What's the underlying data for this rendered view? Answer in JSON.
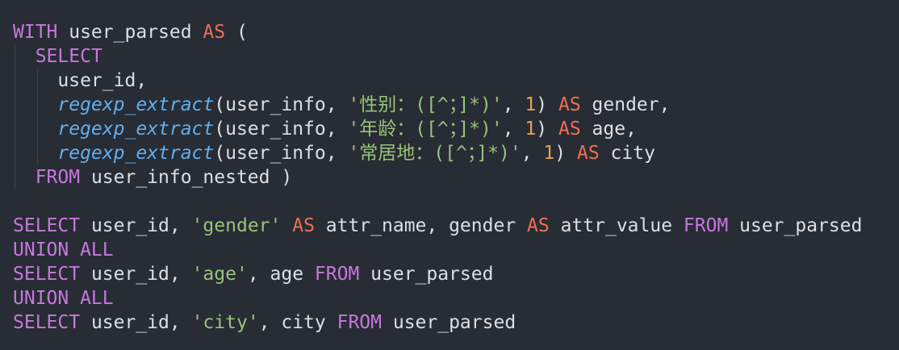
{
  "editor": {
    "lines": [
      {
        "indent": 0,
        "tokens": [
          {
            "t": "WITH",
            "k": "keyword"
          },
          {
            "t": " user_parsed ",
            "k": "ident"
          },
          {
            "t": "AS",
            "k": "as"
          },
          {
            "t": " (",
            "k": "punct"
          }
        ]
      },
      {
        "indent": 1,
        "tokens": [
          {
            "t": "SELECT",
            "k": "keyword"
          }
        ]
      },
      {
        "indent": 2,
        "tokens": [
          {
            "t": "user_id,",
            "k": "ident"
          }
        ]
      },
      {
        "indent": 2,
        "tokens": [
          {
            "t": "regexp_extract",
            "k": "func"
          },
          {
            "t": "(user_info, ",
            "k": "ident"
          },
          {
            "t": "'性别：([^；]*)'",
            "k": "string"
          },
          {
            "t": ", ",
            "k": "punct"
          },
          {
            "t": "1",
            "k": "number"
          },
          {
            "t": ") ",
            "k": "punct"
          },
          {
            "t": "AS",
            "k": "as"
          },
          {
            "t": " gender,",
            "k": "ident"
          }
        ]
      },
      {
        "indent": 2,
        "tokens": [
          {
            "t": "regexp_extract",
            "k": "func"
          },
          {
            "t": "(user_info, ",
            "k": "ident"
          },
          {
            "t": "'年龄：([^；]*)'",
            "k": "string"
          },
          {
            "t": ", ",
            "k": "punct"
          },
          {
            "t": "1",
            "k": "number"
          },
          {
            "t": ") ",
            "k": "punct"
          },
          {
            "t": "AS",
            "k": "as"
          },
          {
            "t": " age,",
            "k": "ident"
          }
        ]
      },
      {
        "indent": 2,
        "tokens": [
          {
            "t": "regexp_extract",
            "k": "func"
          },
          {
            "t": "(user_info, ",
            "k": "ident"
          },
          {
            "t": "'常居地：([^；]*)'",
            "k": "string"
          },
          {
            "t": ", ",
            "k": "punct"
          },
          {
            "t": "1",
            "k": "number"
          },
          {
            "t": ") ",
            "k": "punct"
          },
          {
            "t": "AS",
            "k": "as"
          },
          {
            "t": " city",
            "k": "ident"
          }
        ]
      },
      {
        "indent": 1,
        "tokens": [
          {
            "t": "FROM",
            "k": "keyword"
          },
          {
            "t": " user_info_nested )",
            "k": "ident"
          }
        ]
      },
      {
        "indent": 0,
        "tokens": []
      },
      {
        "indent": 0,
        "tokens": [
          {
            "t": "SELECT",
            "k": "keyword"
          },
          {
            "t": " user_id, ",
            "k": "ident"
          },
          {
            "t": "'gender'",
            "k": "string"
          },
          {
            "t": " ",
            "k": "punct"
          },
          {
            "t": "AS",
            "k": "as"
          },
          {
            "t": " attr_name, gender ",
            "k": "ident"
          },
          {
            "t": "AS",
            "k": "as"
          },
          {
            "t": " attr_value ",
            "k": "ident"
          },
          {
            "t": "FROM",
            "k": "keyword"
          },
          {
            "t": " user_parsed",
            "k": "ident"
          }
        ]
      },
      {
        "indent": 0,
        "tokens": [
          {
            "t": "UNION ALL",
            "k": "keyword"
          }
        ]
      },
      {
        "indent": 0,
        "tokens": [
          {
            "t": "SELECT",
            "k": "keyword"
          },
          {
            "t": " user_id, ",
            "k": "ident"
          },
          {
            "t": "'age'",
            "k": "string"
          },
          {
            "t": ", age ",
            "k": "ident"
          },
          {
            "t": "FROM",
            "k": "keyword"
          },
          {
            "t": " user_parsed",
            "k": "ident"
          }
        ]
      },
      {
        "indent": 0,
        "tokens": [
          {
            "t": "UNION ALL",
            "k": "keyword"
          }
        ]
      },
      {
        "indent": 0,
        "tokens": [
          {
            "t": "SELECT",
            "k": "keyword"
          },
          {
            "t": " user_id, ",
            "k": "ident"
          },
          {
            "t": "'city'",
            "k": "string"
          },
          {
            "t": ", city ",
            "k": "ident"
          },
          {
            "t": "FROM",
            "k": "keyword"
          },
          {
            "t": " user_parsed",
            "k": "ident"
          }
        ]
      }
    ]
  },
  "colors": {
    "background": "#282c34",
    "keyword": "#c678dd",
    "as_keyword": "#ef6f55",
    "function": "#61afef",
    "string": "#98c379",
    "number": "#e5a14f",
    "text": "#dcdfe4",
    "indent_guide": "#3b4048"
  }
}
